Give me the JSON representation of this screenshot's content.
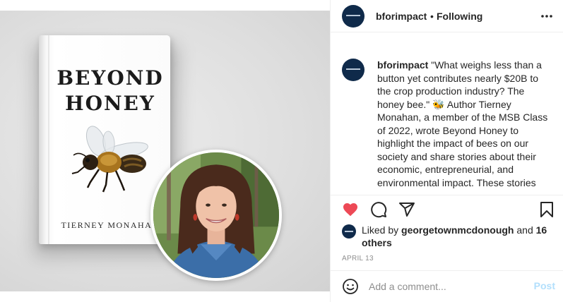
{
  "post": {
    "book": {
      "title_line1": "BEYOND",
      "title_line2": "HONEY",
      "author": "TIERNEY MONAHAN"
    }
  },
  "header": {
    "username": "bforimpact",
    "separator": "•",
    "follow_status": "Following",
    "more_icon": "more-horizontal-icon"
  },
  "caption": {
    "username": "bforimpact",
    "text": "\"What weighs less than a button yet contributes nearly $20B to the crop production industry? The honey bee.\" 🐝 Author Tierney Monahan, a member of the MSB Class of 2022, wrote Beyond Honey to highlight the impact of bees on our society and share stories about their economic, entrepreneurial, and environmental impact. These stories"
  },
  "actions": {
    "like_icon": "heart-filled-icon",
    "comment_icon": "comment-icon",
    "share_icon": "share-icon",
    "save_icon": "bookmark-icon",
    "liked": true
  },
  "likes": {
    "prefix": "Liked by",
    "user": "georgetownmcdonough",
    "conjunction": "and",
    "others": "16 others"
  },
  "date": "APRIL 13",
  "comment": {
    "emoji_icon": "smiley-icon",
    "placeholder": "Add a comment...",
    "post_label": "Post"
  },
  "colors": {
    "like_red": "#ed4956",
    "post_button_disabled": "#b2dffc",
    "avatar_navy": "#0f2a4a",
    "muted_text": "#8e8e8e"
  }
}
